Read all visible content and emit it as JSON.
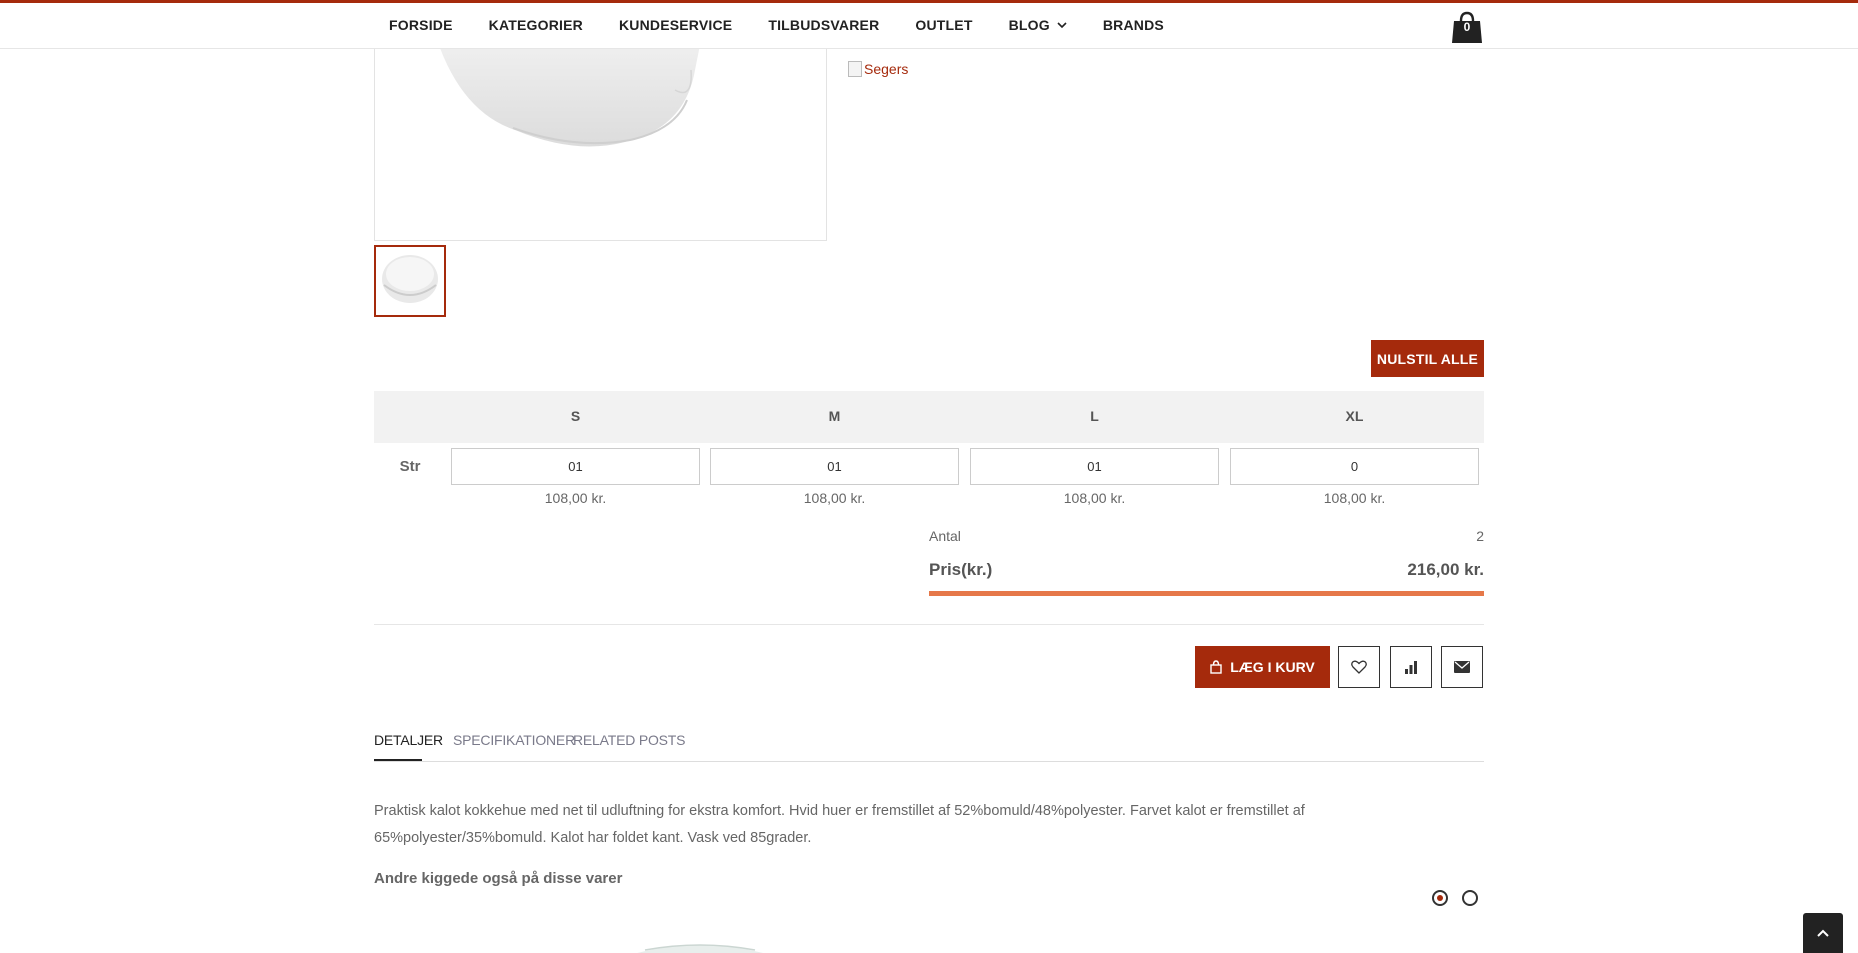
{
  "nav": {
    "items": [
      {
        "label": "FORSIDE",
        "has_dropdown": false
      },
      {
        "label": "KATEGORIER",
        "has_dropdown": false
      },
      {
        "label": "KUNDESERVICE",
        "has_dropdown": false
      },
      {
        "label": "TILBUDSVARER",
        "has_dropdown": false
      },
      {
        "label": "OUTLET",
        "has_dropdown": false
      },
      {
        "label": "BLOG",
        "has_dropdown": true
      },
      {
        "label": "BRANDS",
        "has_dropdown": false
      }
    ],
    "cart_count": "0",
    "cart_icon": "shopping-bag-icon"
  },
  "product": {
    "brand_alt": "Segers"
  },
  "matrix": {
    "reset_label": "NULSTIL ALLE",
    "row_label": "Str",
    "sizes": [
      {
        "name": "S",
        "qty": "01",
        "price": "108,00 kr."
      },
      {
        "name": "M",
        "qty": "01",
        "price": "108,00 kr."
      },
      {
        "name": "L",
        "qty": "01",
        "price": "108,00 kr."
      },
      {
        "name": "XL",
        "qty": "0",
        "price": "108,00 kr."
      }
    ],
    "antal_label": "Antal",
    "antal_value": "2",
    "pris_label": "Pris(kr.)",
    "pris_value": "216,00 kr.",
    "accent_color": "#e67849"
  },
  "actions": {
    "add_to_cart": "LÆG I KURV",
    "icons": [
      "heart-icon",
      "bar-chart-icon",
      "envelope-icon"
    ]
  },
  "tabs": [
    {
      "label": "DETALJER",
      "active": true
    },
    {
      "label": "SPECIFIKATIONER",
      "active": false
    },
    {
      "label": "RELATED POSTS",
      "active": false
    }
  ],
  "description": "Praktisk kalot kokkehue med net til udluftning for ekstra komfort. Hvid huer er fremstillet af 52%bomuld/48%polyester. Farvet kalot er fremstillet af 65%polyester/35%bomuld. Kalot har foldet kant. Vask ved 85grader.",
  "also_viewed": "Andre kiggede også på disse varer",
  "colors": {
    "brand": "#a52a0c",
    "dark": "#222222"
  }
}
